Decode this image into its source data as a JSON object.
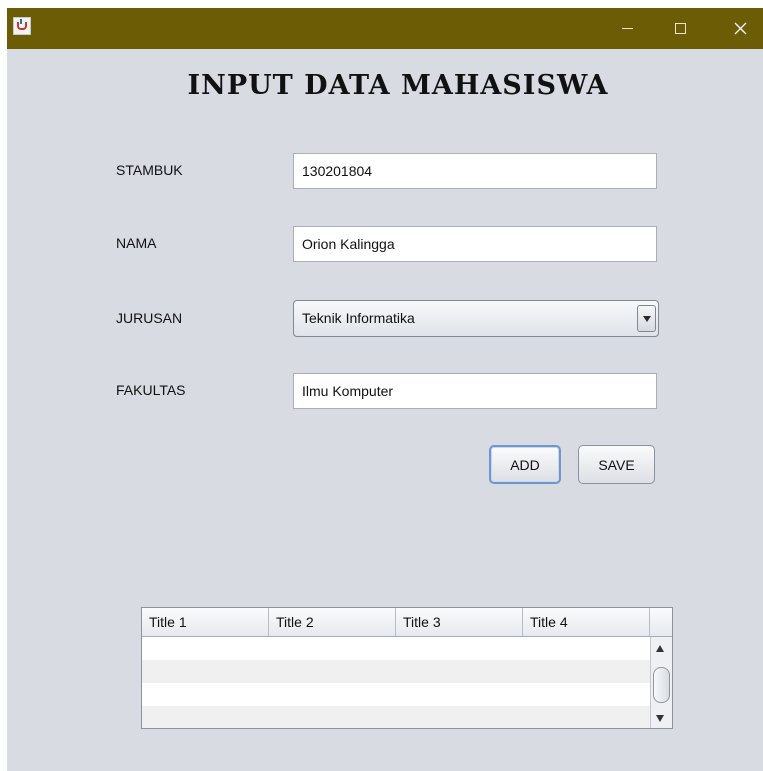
{
  "window": {
    "controls": {
      "minimize_icon": "minimize-icon",
      "maximize_icon": "maximize-icon",
      "close_icon": "close-icon"
    },
    "colors": {
      "titlebar": "#6d5c06",
      "background": "#d9dbe2"
    }
  },
  "form": {
    "heading": "INPUT DATA MAHASISWA",
    "stambuk": {
      "label": "STAMBUK",
      "value": "130201804"
    },
    "nama": {
      "label": "NAMA",
      "value": "Orion Kalingga"
    },
    "jurusan": {
      "label": "JURUSAN",
      "selected": "Teknik Informatika"
    },
    "fakultas": {
      "label": "FAKULTAS",
      "value": "Ilmu Komputer"
    },
    "add_label": "ADD",
    "save_label": "SAVE"
  },
  "table": {
    "columns": [
      "Title 1",
      "Title 2",
      "Title 3",
      "Title 4"
    ],
    "rows": []
  }
}
